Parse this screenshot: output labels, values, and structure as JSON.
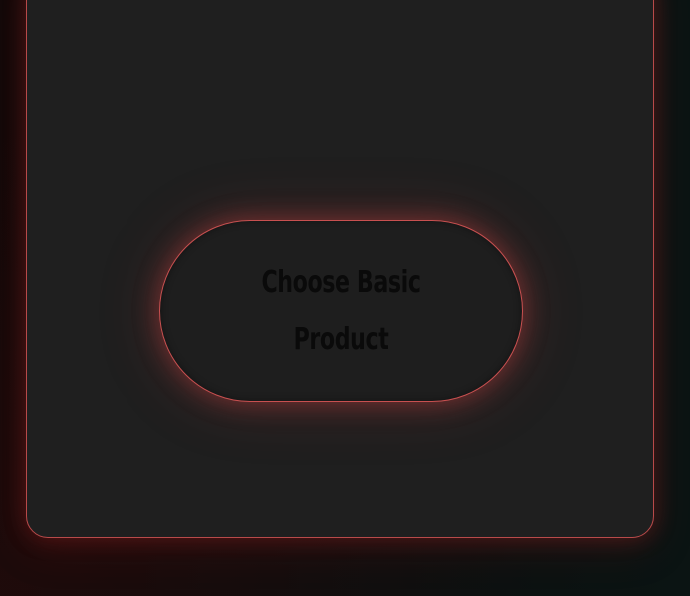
{
  "product_card": {
    "button": {
      "label": "Choose Basic Product"
    }
  },
  "colors": {
    "accent_border": "#c85050",
    "card_background": "#1f1f1f",
    "button_text": "#0a0a0a",
    "page_background": "#0c0d0d"
  }
}
